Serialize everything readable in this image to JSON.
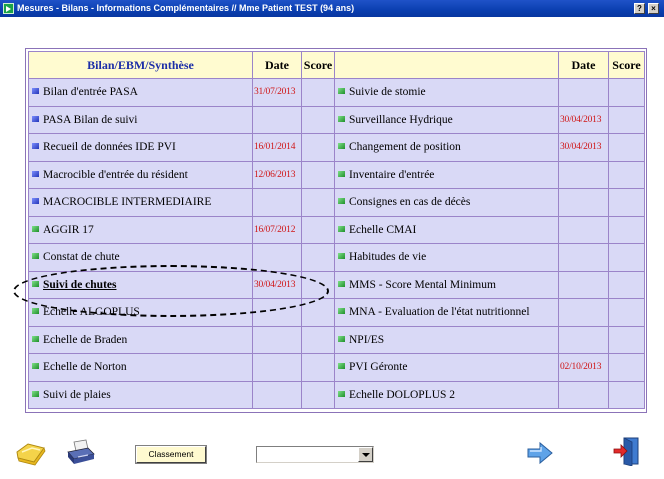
{
  "window": {
    "title": "Mesures - Bilans - Informations Complémentaires  // Mme Patient TEST (94 ans)",
    "help_label": "?",
    "close_label": "×"
  },
  "table": {
    "headers": {
      "left_label": "Bilan/EBM/Synthèse",
      "date": "Date",
      "score": "Score",
      "right_label": ""
    },
    "rows": [
      {
        "left": {
          "label": "Bilan d'entrée PASA",
          "marker": "blue",
          "date": "31/07/2013",
          "score": ""
        },
        "right": {
          "label": "Suivie de stomie",
          "marker": "green",
          "date": "",
          "score": ""
        }
      },
      {
        "left": {
          "label": "PASA Bilan de suivi",
          "marker": "blue",
          "date": "",
          "score": ""
        },
        "right": {
          "label": "Surveillance Hydrique",
          "marker": "green",
          "date": "30/04/2013",
          "score": ""
        }
      },
      {
        "left": {
          "label": "Recueil de données IDE PVI",
          "marker": "blue",
          "date": "16/01/2014",
          "score": ""
        },
        "right": {
          "label": "Changement de position",
          "marker": "green",
          "date": "30/04/2013",
          "score": ""
        }
      },
      {
        "left": {
          "label": "Macrocible d'entrée du résident",
          "marker": "blue",
          "date": "12/06/2013",
          "score": ""
        },
        "right": {
          "label": "Inventaire d'entrée",
          "marker": "green",
          "date": "",
          "score": ""
        }
      },
      {
        "left": {
          "label": "MACROCIBLE INTERMEDIAIRE",
          "marker": "blue",
          "date": "",
          "score": ""
        },
        "right": {
          "label": "Consignes en cas de décès",
          "marker": "green",
          "date": "",
          "score": ""
        }
      },
      {
        "left": {
          "label": "AGGIR 17",
          "marker": "green",
          "date": "16/07/2012",
          "score": ""
        },
        "right": {
          "label": "Echelle CMAI",
          "marker": "green",
          "date": "",
          "score": ""
        }
      },
      {
        "left": {
          "label": "Constat de chute",
          "marker": "green",
          "date": "",
          "score": ""
        },
        "right": {
          "label": "Habitudes de vie",
          "marker": "green",
          "date": "",
          "score": ""
        }
      },
      {
        "left": {
          "label": "Suivi de chutes",
          "marker": "green",
          "date": "30/04/2013",
          "score": "",
          "emphasis": true
        },
        "right": {
          "label": "MMS - Score Mental Minimum",
          "marker": "green",
          "date": "",
          "score": ""
        }
      },
      {
        "left": {
          "label": "Echelle ALGOPLUS",
          "marker": "green",
          "date": "",
          "score": ""
        },
        "right": {
          "label": "MNA - Evaluation de l'état nutritionnel",
          "marker": "green",
          "date": "",
          "score": ""
        }
      },
      {
        "left": {
          "label": "Echelle de Braden",
          "marker": "green",
          "date": "",
          "score": ""
        },
        "right": {
          "label": "NPI/ES",
          "marker": "green",
          "date": "",
          "score": ""
        }
      },
      {
        "left": {
          "label": "Echelle de Norton",
          "marker": "green",
          "date": "",
          "score": ""
        },
        "right": {
          "label": "PVI Géronte",
          "marker": "green",
          "date": "02/10/2013",
          "score": ""
        }
      },
      {
        "left": {
          "label": "Suivi de plaies",
          "marker": "green",
          "date": "",
          "score": ""
        },
        "right": {
          "label": "Echelle DOLOPLUS 2",
          "marker": "green",
          "date": "",
          "score": ""
        }
      }
    ]
  },
  "toolbar": {
    "classement_label": "Classement",
    "select_value": "",
    "icons": [
      "folder-icon",
      "printer-icon",
      "next-arrow-icon",
      "exit-door-icon"
    ]
  },
  "colors": {
    "titlebar": "#0a3fb0",
    "header_bg": "#fffbd0",
    "header_text": "#1c2ea8",
    "row_bg": "#d9d9f6",
    "grid_border": "#9b84c9",
    "date_text": "#d01515"
  }
}
